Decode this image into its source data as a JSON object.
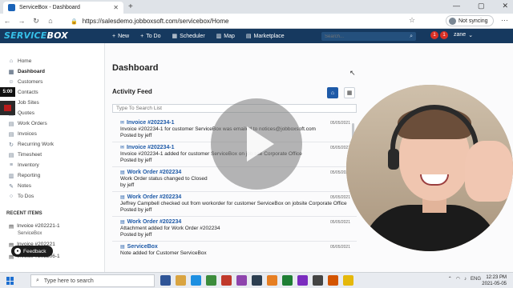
{
  "browser": {
    "tab_title": "ServiceBox - Dashboard",
    "url": "https://salesdemo.jobboxsoft.com/servicebox/Home",
    "sync_label": "Not syncing",
    "window_controls": [
      "—",
      "▢",
      "✕"
    ]
  },
  "app": {
    "logo_part1": "SERVICE",
    "logo_part2": "BOX",
    "menu": [
      {
        "icon": "plus-icon",
        "glyph": "+",
        "label": "New"
      },
      {
        "icon": "plus-icon",
        "glyph": "+",
        "label": "To Do"
      },
      {
        "icon": "calendar-icon",
        "glyph": "▦",
        "label": "Scheduler"
      },
      {
        "icon": "map-icon",
        "glyph": "▥",
        "label": "Map"
      },
      {
        "icon": "marketplace-icon",
        "glyph": "▤",
        "label": "Marketplace"
      }
    ],
    "search_placeholder": "Search...",
    "user_name": "zane",
    "badges": [
      "1",
      "1"
    ]
  },
  "sidebar": {
    "items": [
      {
        "label": "Home",
        "icon": "home-icon",
        "glyph": "⌂"
      },
      {
        "label": "Dashboard",
        "icon": "dashboard-icon",
        "glyph": "▦",
        "active": true
      },
      {
        "label": "Customers",
        "icon": "customers-icon",
        "glyph": "☺"
      },
      {
        "label": "Contacts",
        "icon": "contacts-icon",
        "glyph": "☺"
      },
      {
        "label": "Job Sites",
        "icon": "job-sites-icon",
        "glyph": "▣"
      },
      {
        "label": "Quotes",
        "icon": "quotes-icon",
        "glyph": "▤"
      },
      {
        "label": "Work Orders",
        "icon": "work-orders-icon",
        "glyph": "▤"
      },
      {
        "label": "Invoices",
        "icon": "invoices-icon",
        "glyph": "▤"
      },
      {
        "label": "Recurring Work",
        "icon": "recurring-icon",
        "glyph": "↻"
      },
      {
        "label": "Timesheet",
        "icon": "timesheet-icon",
        "glyph": "▤"
      },
      {
        "label": "Inventory",
        "icon": "inventory-icon",
        "glyph": "≡"
      },
      {
        "label": "Reporting",
        "icon": "reporting-icon",
        "glyph": "▥"
      },
      {
        "label": "Notes",
        "icon": "notes-icon",
        "glyph": "✎"
      },
      {
        "label": "To Dos",
        "icon": "todos-icon",
        "glyph": "○"
      }
    ],
    "recent_title": "RECENT ITEMS",
    "recent": [
      {
        "label": "Invoice #202221-1",
        "sub": "ServiceBox"
      },
      {
        "label": "Invoice #202221",
        "sub": ""
      },
      {
        "label": "Invoice #202206-1",
        "sub": ""
      }
    ],
    "time_badge": "5:00",
    "feedback_label": "Feedback"
  },
  "main": {
    "title": "Dashboard",
    "feed_title": "Activity Feed",
    "feed_search_placeholder": "Type To Search List",
    "entries": [
      {
        "icon": "email-icon",
        "glyph": "✉",
        "title": "Invoice #202234-1",
        "date": "05/05/2021",
        "text": "Invoice #202234-1 for customer ServiceBox was emailed to notices@jobboxsoft.com",
        "by": "Posted by jeff"
      },
      {
        "icon": "email-icon",
        "glyph": "✉",
        "title": "Invoice #202234-1",
        "date": "05/05/2021",
        "text": "Invoice #202234-1 added for customer ServiceBox on job site Corporate Office",
        "by": "Posted by jeff"
      },
      {
        "icon": "document-icon",
        "glyph": "▤",
        "title": "Work Order #202234",
        "date": "05/05/2021",
        "text": "Work Order status changed to Closed",
        "by": "by jeff"
      },
      {
        "icon": "document-icon",
        "glyph": "▤",
        "title": "Work Order #202234",
        "date": "05/05/2021",
        "text": "Jeffrey Campbell checked out from workorder for customer ServiceBox on jobsite Corporate Office",
        "by": "Posted by jeff"
      },
      {
        "icon": "document-icon",
        "glyph": "▤",
        "title": "Work Order #202234",
        "date": "05/05/2021",
        "text": "Attachment added for Work Order #202234",
        "by": "Posted by jeff"
      },
      {
        "icon": "document-icon",
        "glyph": "▤",
        "title": "ServiceBox",
        "date": "05/05/2021",
        "text": "Note added for Customer ServiceBox",
        "by": ""
      }
    ]
  },
  "taskbar": {
    "search_placeholder": "Type here to search",
    "tray_lang": "ENG",
    "time": "12:23 PM",
    "date": "2021-05-05"
  },
  "colors": {
    "header_bg": "#16395f",
    "accent": "#1e5aa8",
    "logo_accent": "#36c0e8"
  }
}
